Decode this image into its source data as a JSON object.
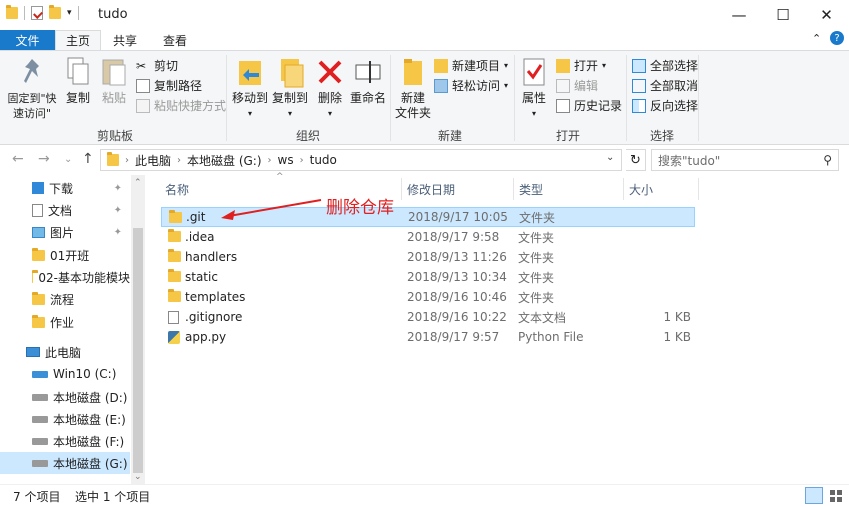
{
  "window": {
    "title": "tudo",
    "controls": {
      "minimize": "—",
      "maximize": "☐",
      "close": "✕"
    }
  },
  "ribbon_tabs": {
    "file": "文件",
    "home": "主页",
    "share": "共享",
    "view": "查看"
  },
  "ribbon": {
    "clipboard": {
      "label": "剪贴板",
      "pin": "固定到\"快速访问\"",
      "copy": "复制",
      "paste": "粘贴",
      "cut": "剪切",
      "copy_path": "复制路径",
      "paste_shortcut": "粘贴快捷方式"
    },
    "organize": {
      "label": "组织",
      "move_to": "移动到",
      "copy_to": "复制到",
      "delete": "删除",
      "rename": "重命名"
    },
    "new": {
      "label": "新建",
      "new_folder": "新建\n文件夹",
      "new_item": "新建项目",
      "easy_access": "轻松访问"
    },
    "open": {
      "label": "打开",
      "properties": "属性",
      "open": "打开",
      "edit": "编辑",
      "history": "历史记录"
    },
    "select": {
      "label": "选择",
      "select_all": "全部选择",
      "select_none": "全部取消",
      "invert": "反向选择"
    }
  },
  "address": {
    "crumbs": [
      "此电脑",
      "本地磁盘 (G:)",
      "ws",
      "tudo"
    ]
  },
  "search": {
    "placeholder": "搜索\"tudo\""
  },
  "nav": {
    "quick": [
      {
        "label": "下载",
        "icon": "download-icon",
        "pinned": true
      },
      {
        "label": "文档",
        "icon": "document-icon",
        "pinned": true
      },
      {
        "label": "图片",
        "icon": "picture-icon",
        "pinned": true
      },
      {
        "label": "01开班",
        "icon": "folder-icon",
        "pinned": false
      },
      {
        "label": "02-基本功能模块",
        "icon": "folder-icon",
        "pinned": false
      },
      {
        "label": "流程",
        "icon": "folder-icon",
        "pinned": false
      },
      {
        "label": "作业",
        "icon": "folder-icon",
        "pinned": false
      }
    ],
    "pc": "此电脑",
    "drives": [
      "Win10 (C:)",
      "本地磁盘 (D:)",
      "本地磁盘 (E:)",
      "本地磁盘 (F:)",
      "本地磁盘 (G:)"
    ]
  },
  "columns": {
    "name": "名称",
    "modified": "修改日期",
    "type": "类型",
    "size": "大小"
  },
  "files": [
    {
      "name": ".git",
      "modified": "2018/9/17 10:05",
      "type": "文件夹",
      "size": "",
      "icon": "folder-icon",
      "selected": true
    },
    {
      "name": ".idea",
      "modified": "2018/9/17 9:58",
      "type": "文件夹",
      "size": "",
      "icon": "folder-icon",
      "selected": false
    },
    {
      "name": "handlers",
      "modified": "2018/9/13 11:26",
      "type": "文件夹",
      "size": "",
      "icon": "folder-icon",
      "selected": false
    },
    {
      "name": "static",
      "modified": "2018/9/13 10:34",
      "type": "文件夹",
      "size": "",
      "icon": "folder-icon",
      "selected": false
    },
    {
      "name": "templates",
      "modified": "2018/9/16 10:46",
      "type": "文件夹",
      "size": "",
      "icon": "folder-icon",
      "selected": false
    },
    {
      "name": ".gitignore",
      "modified": "2018/9/16 10:22",
      "type": "文本文档",
      "size": "1 KB",
      "icon": "text-file-icon",
      "selected": false
    },
    {
      "name": "app.py",
      "modified": "2018/9/17 9:57",
      "type": "Python File",
      "size": "1 KB",
      "icon": "python-file-icon",
      "selected": false
    }
  ],
  "annotation": "删除仓库",
  "status": {
    "count": "7 个项目",
    "selected": "选中 1 个项目"
  },
  "colors": {
    "accent": "#1979ca",
    "selection": "#cce8ff",
    "annotation": "#e02020"
  }
}
